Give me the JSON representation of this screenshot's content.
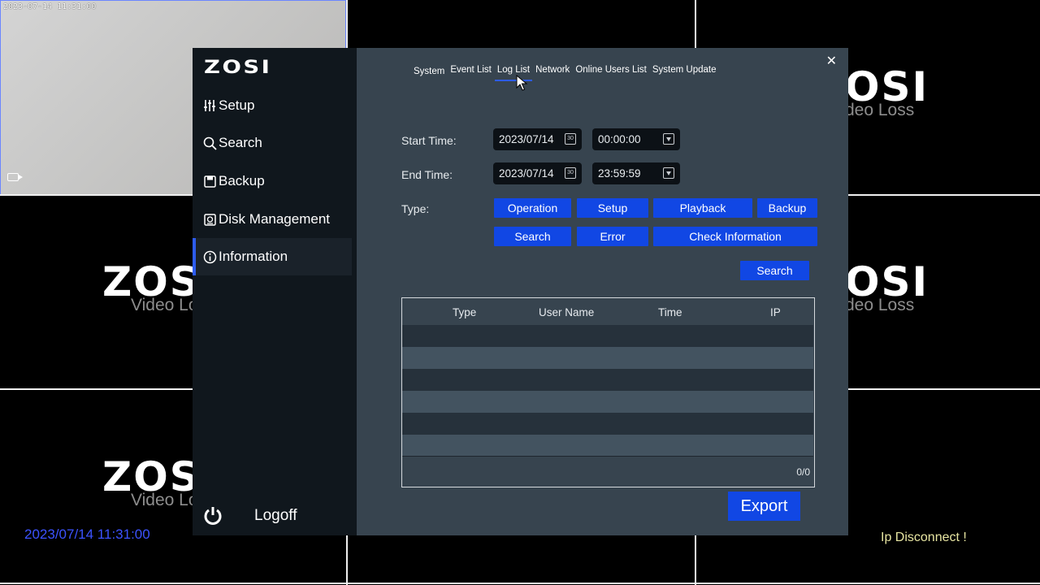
{
  "camera_grid": {
    "live_tile": {
      "osd_timestamp": "2023-07-14 11:31:00",
      "camera_icon": "video-camera-icon"
    },
    "watermark": "ZOSI",
    "watermark_partial": "ZOS",
    "video_loss": "Video Loss",
    "video_loss_partial_left": "Video Los",
    "video_loss_partial_right": "deo Loss",
    "watermark_partial_right": "OSI"
  },
  "overlay": {
    "date_time": "2023/07/14 11:31:00",
    "ip_status": "Ip Disconnect !"
  },
  "sidebar": {
    "logo": "ZOSI",
    "items": [
      {
        "label": "Setup",
        "icon": "sliders-icon"
      },
      {
        "label": "Search",
        "icon": "magnifier-icon"
      },
      {
        "label": "Backup",
        "icon": "floppy-disk-icon"
      },
      {
        "label": "Disk Management",
        "icon": "disk-icon"
      },
      {
        "label": "Information",
        "icon": "info-circle-icon",
        "active": true
      }
    ],
    "logoff": {
      "label": "Logoff",
      "icon": "power-icon"
    }
  },
  "main": {
    "close_icon": "close-icon",
    "tabs": [
      {
        "label": "System"
      },
      {
        "label": "Event List"
      },
      {
        "label": "Log List",
        "active": true
      },
      {
        "label": "Network"
      },
      {
        "label": "Online Users List"
      },
      {
        "label": "System Update"
      }
    ],
    "form": {
      "start_label": "Start Time:",
      "start_date": "2023/07/14",
      "start_time": "00:00:00",
      "end_label": "End Time:",
      "end_date": "2023/07/14",
      "end_time": "23:59:59",
      "calendar_glyph": "30",
      "type_label": "Type:",
      "types": [
        "Operation",
        "Setup",
        "Playback",
        "Backup",
        "Search",
        "Error",
        "Check Information"
      ],
      "search_button": "Search"
    },
    "table": {
      "columns": [
        "Type",
        "User Name",
        "Time",
        "IP"
      ],
      "rows": [],
      "page_count": "0/0"
    },
    "export_button": "Export"
  },
  "colors": {
    "accent": "#1147e4",
    "sidebar_bg": "#10171d",
    "panel_bg": "#37444f",
    "date_color": "#3c53ff",
    "warning_text": "#e8e6a2"
  }
}
